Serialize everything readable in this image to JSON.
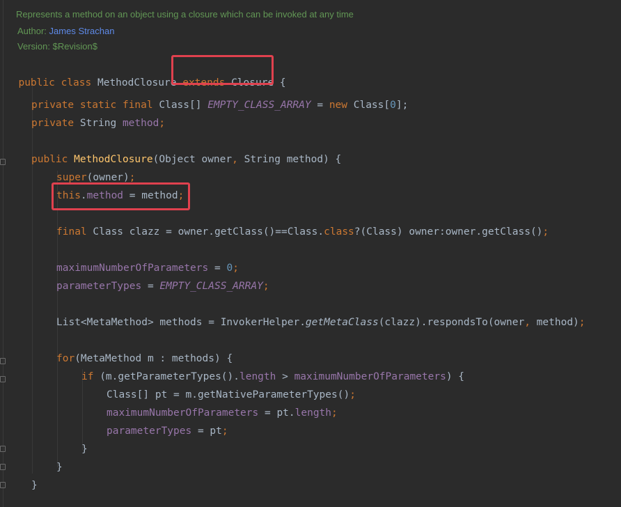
{
  "doc": {
    "summary": "Represents a method on an object using a closure which can be invoked at any time",
    "author_label": "Author:",
    "author_value": "James Strachan",
    "version_label": "Version:",
    "version_value": "$Revision$"
  },
  "code": {
    "l1_public": "public",
    "l1_class": "class",
    "l1_name": "MethodClosure",
    "l1_extends": "extends",
    "l1_super": "Closure",
    "l1_brace": "{",
    "l2_private": "private",
    "l2_static": "static",
    "l2_final": "final",
    "l2_type": "Class[]",
    "l2_field": "EMPTY_CLASS_ARRAY",
    "l2_eq": " = ",
    "l2_new": "new",
    "l2_ctor": " Class[",
    "l2_num": "0",
    "l2_end": "];",
    "l3_private": "private",
    "l3_type": " String ",
    "l3_field": "method",
    "l3_semi": ";",
    "l4_public": "public",
    "l4_ctor": "MethodClosure",
    "l4_params_a": "(Object owner",
    "l4_comma": ",",
    "l4_params_b": " String method) {",
    "l5_super": "super",
    "l5_args": "(owner)",
    "l5_semi": ";",
    "l6_this": "this",
    "l6_dot": ".",
    "l6_field": "method",
    "l6_rest": " = method",
    "l6_semi": ";",
    "l7_final": "final",
    "l7_a": " Class clazz = owner.getClass()==Class.",
    "l7_class": "class",
    "l7_b": "?(Class) owner:owner.getClass()",
    "l7_semi": ";",
    "l8_field": "maximumNumberOfParameters",
    "l8_eq": " = ",
    "l8_num": "0",
    "l8_semi": ";",
    "l9_field": "parameterTypes",
    "l9_eq": " = ",
    "l9_sfield": "EMPTY_CLASS_ARRAY",
    "l9_semi": ";",
    "l10_a": "List<MetaMethod> methods = InvokerHelper.",
    "l10_smeth": "getMetaClass",
    "l10_b": "(clazz).respondsTo(owner",
    "l10_comma": ",",
    "l10_c": " method)",
    "l10_semi": ";",
    "l11_for": "for",
    "l11_rest": "(MetaMethod m : methods) {",
    "l12_if": "if",
    "l12_a": " (m.getParameterTypes().",
    "l12_len": "length",
    "l12_gt": " > ",
    "l12_field": "maximumNumberOfParameters",
    "l12_b": ") {",
    "l13_a": "Class[] pt = m.getNativeParameterTypes()",
    "l13_semi": ";",
    "l14_field": "maximumNumberOfParameters",
    "l14_a": " = pt.",
    "l14_len": "length",
    "l14_semi": ";",
    "l15_field": "parameterTypes",
    "l15_a": " = pt",
    "l15_semi": ";",
    "l16": "}",
    "l17": "}",
    "l18": "}"
  },
  "colors": {
    "background": "#2b2b2b",
    "keyword": "#cc7832",
    "field": "#9876aa",
    "method_decl": "#ffc66d",
    "number": "#6897bb",
    "doc_comment": "#629755",
    "highlight_box": "#e0414e"
  }
}
